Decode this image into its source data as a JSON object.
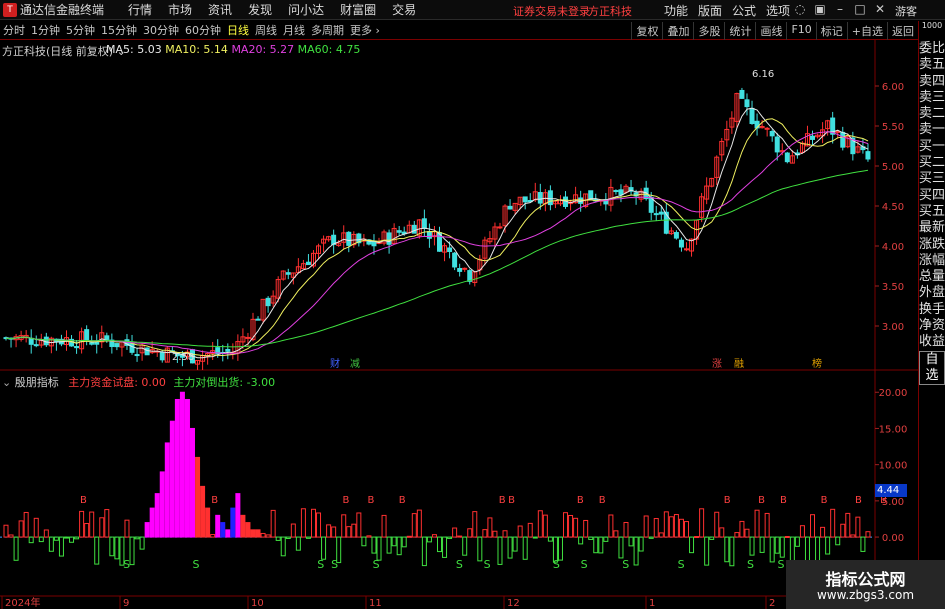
{
  "app": {
    "logo": "T",
    "title": "通达信金融终端",
    "login_notice": "证券交易未登录",
    "company": "方正科技",
    "guest": "游客"
  },
  "menu": [
    "行情",
    "市场",
    "资讯",
    "发现",
    "问小达",
    "财富圈",
    "交易"
  ],
  "right_menu": [
    "功能",
    "版面",
    "公式",
    "选项"
  ],
  "toolbar": {
    "periods": [
      "分时",
      "1分钟",
      "5分钟",
      "15分钟",
      "30分钟",
      "60分钟",
      "日线",
      "周线",
      "月线",
      "多周期",
      "更多"
    ],
    "active": "日线",
    "more_arrow": "›",
    "right_buttons": [
      "复权",
      "叠加",
      "多股",
      "统计",
      "画线",
      "F10",
      "标记",
      "+自选",
      "返回"
    ]
  },
  "sidebar": {
    "top": "1000",
    "items": [
      "委比",
      "卖五",
      "卖四",
      "卖三",
      "卖二",
      "卖一",
      "买一",
      "买二",
      "买三",
      "买四",
      "买五",
      "最新",
      "涨跌",
      "涨幅",
      "总量",
      "外盘",
      "换手",
      "净资",
      "收益",
      "自选"
    ]
  },
  "main_chart": {
    "title": "方正科技(日线 前复权)",
    "legend": [
      {
        "label": "MA5: 5.03",
        "color": "#e8e8e8"
      },
      {
        "label": "MA10: 5.14",
        "color": "#f0f060"
      },
      {
        "label": "MA20: 5.27",
        "color": "#e040e0"
      },
      {
        "label": "MA60: 4.75",
        "color": "#40e040"
      }
    ],
    "y_ticks": [
      "6.00",
      "5.50",
      "5.00",
      "4.50",
      "4.00",
      "3.50",
      "3.00"
    ],
    "high_label": "6.16",
    "low_label": "2.58",
    "event_tags": [
      {
        "text": "财",
        "color": "#4060ff"
      },
      {
        "text": "减",
        "color": "#40c040"
      },
      {
        "text": "涨",
        "color": "#e04040"
      },
      {
        "text": "融",
        "color": "#e0a000"
      },
      {
        "text": "榜",
        "color": "#e0a000"
      }
    ]
  },
  "sub_chart": {
    "title": "殷朋指标",
    "label_main": "主力资金试盘: 0.00",
    "label_exit": "主力对倒出货: -3.00",
    "y_ticks": [
      "20.00",
      "15.00",
      "10.00",
      "5.00",
      "0.00"
    ],
    "current_value": "4.44",
    "buy_mark": "B",
    "sell_mark": "S"
  },
  "x_axis": [
    "2024年",
    "9",
    "10",
    "11",
    "12",
    "1",
    "2"
  ],
  "watermark": {
    "title": "指标公式网",
    "url": "www.zbgs3.com"
  },
  "colors": {
    "up": "#ff3030",
    "down": "#40e0e0",
    "ma5": "#e8e8e8",
    "ma10": "#f0f060",
    "ma20": "#e040e0",
    "ma60": "#40e040",
    "pink": "#ff00ff",
    "blue": "#2020ff",
    "zero_line": "#40a0ff"
  },
  "chart_data": {
    "type": "candlestick",
    "ylim": [
      2.5,
      6.35
    ],
    "ma_last": {
      "MA5": 5.03,
      "MA10": 5.14,
      "MA20": 5.27,
      "MA60": 4.75
    },
    "high": 6.16,
    "low": 2.58
  }
}
